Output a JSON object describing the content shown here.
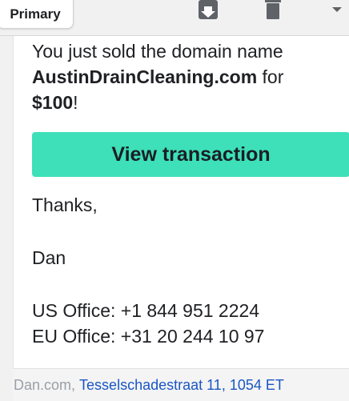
{
  "toolbar": {
    "tab_label": "Primary",
    "icons": [
      "archive-icon",
      "trash-icon",
      "chevron-down-icon"
    ]
  },
  "email": {
    "sold_text": "You just sold the domain name",
    "domain": "AustinDrainCleaning.com",
    "for_text": " for",
    "price": "$100",
    "exclaim": "!",
    "button_label": "View transaction",
    "thanks": "Thanks,",
    "signature": "Dan",
    "us_office": "US Office: +1 844 951 2224",
    "eu_office": "EU Office: +31 20 244 10 97"
  },
  "footer": {
    "company": "Dan.com,",
    "address": "Tesselschadestraat 11, 1054 ET"
  },
  "colors": {
    "accent": "#3de0b8",
    "link": "#1a56c4",
    "muted": "#9aa0a6"
  }
}
